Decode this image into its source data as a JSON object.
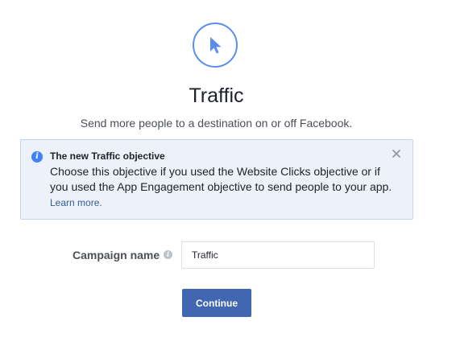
{
  "objective": {
    "icon": "cursor-arrow-icon",
    "title": "Traffic",
    "subtitle": "Send more people to a destination on or off Facebook."
  },
  "notice": {
    "icon": "info-icon",
    "title": "The new Traffic objective",
    "body": "Choose this objective if you used the Website Clicks objective or if you used the App Engagement objective to send people to your app.",
    "learn_more": "Learn more.",
    "close_icon": "close-icon"
  },
  "campaign": {
    "label": "Campaign name",
    "info_icon": "info-icon",
    "value": "Traffic"
  },
  "actions": {
    "continue_label": "Continue"
  },
  "colors": {
    "accent": "#4267b2",
    "icon_blue": "#5b8def",
    "notice_bg": "#edf2fa",
    "link": "#365899"
  }
}
